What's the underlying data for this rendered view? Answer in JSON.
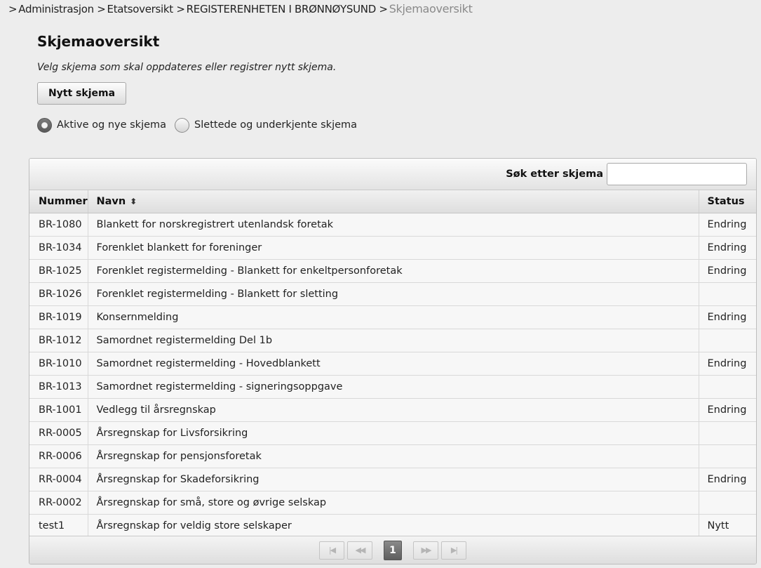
{
  "breadcrumb": {
    "items": [
      {
        "label": "Administrasjon"
      },
      {
        "label": "Etatsoversikt"
      },
      {
        "label": "REGISTERENHETEN I BRØNNØYSUND"
      }
    ],
    "separator": ">",
    "current": "Skjemaoversikt"
  },
  "page": {
    "title": "Skjemaoversikt",
    "subtitle": "Velg skjema som skal oppdateres eller registrer nytt skjema.",
    "new_button": "Nytt skjema"
  },
  "filter": {
    "options": [
      {
        "label": "Aktive og nye skjema",
        "checked": true
      },
      {
        "label": "Slettede og underkjente skjema",
        "checked": false
      }
    ]
  },
  "search": {
    "label": "Søk etter skjema",
    "value": ""
  },
  "table": {
    "columns": [
      {
        "label": "Nummer",
        "sortable": false
      },
      {
        "label": "Navn",
        "sortable": true,
        "sort_icon": "sort-icon"
      },
      {
        "label": "Status",
        "sortable": false
      }
    ],
    "rows": [
      {
        "nummer": "BR-1080",
        "navn": "Blankett for norskregistrert utenlandsk foretak",
        "status": "Endring"
      },
      {
        "nummer": "BR-1034",
        "navn": "Forenklet blankett for foreninger",
        "status": "Endring"
      },
      {
        "nummer": "BR-1025",
        "navn": "Forenklet registermelding - Blankett for enkeltpersonforetak",
        "status": "Endring"
      },
      {
        "nummer": "BR-1026",
        "navn": "Forenklet registermelding - Blankett for sletting",
        "status": ""
      },
      {
        "nummer": "BR-1019",
        "navn": "Konsernmelding",
        "status": "Endring"
      },
      {
        "nummer": "BR-1012",
        "navn": "Samordnet registermelding Del 1b",
        "status": ""
      },
      {
        "nummer": "BR-1010",
        "navn": "Samordnet registermelding - Hovedblankett",
        "status": "Endring"
      },
      {
        "nummer": "BR-1013",
        "navn": "Samordnet registermelding - signeringsoppgave",
        "status": ""
      },
      {
        "nummer": "BR-1001",
        "navn": "Vedlegg til årsregnskap",
        "status": "Endring"
      },
      {
        "nummer": "RR-0005",
        "navn": "Årsregnskap for Livsforsikring",
        "status": ""
      },
      {
        "nummer": "RR-0006",
        "navn": "Årsregnskap for pensjonsforetak",
        "status": ""
      },
      {
        "nummer": "RR-0004",
        "navn": "Årsregnskap for Skadeforsikring",
        "status": "Endring"
      },
      {
        "nummer": "RR-0002",
        "navn": "Årsregnskap for små, store og øvrige selskap",
        "status": ""
      },
      {
        "nummer": "test1",
        "navn": "Årsregnskap for veldig store selskaper",
        "status": "Nytt"
      }
    ]
  },
  "paginator": {
    "first_icon": "first-page-icon",
    "prev_icon": "previous-page-icon",
    "current_page": "1",
    "next_icon": "next-page-icon",
    "last_icon": "last-page-icon"
  }
}
